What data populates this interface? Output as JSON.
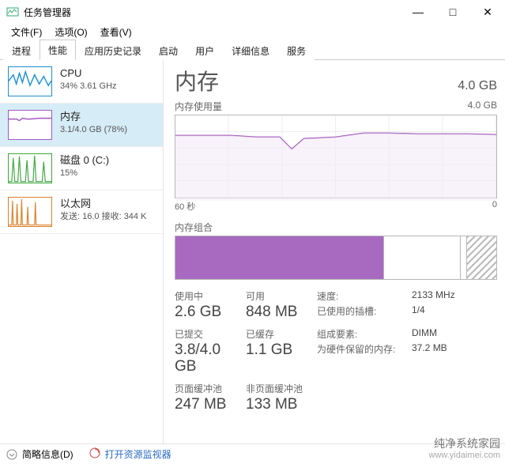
{
  "window": {
    "title": "任务管理器",
    "controls": {
      "min": "—",
      "max": "□",
      "close": "✕"
    }
  },
  "menu": {
    "file": "文件(F)",
    "options": "选项(O)",
    "view": "查看(V)"
  },
  "tabs": {
    "processes": "进程",
    "performance": "性能",
    "history": "应用历史记录",
    "startup": "启动",
    "users": "用户",
    "details": "详细信息",
    "services": "服务"
  },
  "sidebar": [
    {
      "key": "cpu",
      "title": "CPU",
      "sub": "34%  3.61 GHz"
    },
    {
      "key": "memory",
      "title": "内存",
      "sub": "3.1/4.0 GB (78%)"
    },
    {
      "key": "disk",
      "title": "磁盘 0 (C:)",
      "sub": "15%"
    },
    {
      "key": "eth",
      "title": "以太网",
      "sub": "发送: 16.0  接收: 344 K"
    }
  ],
  "main": {
    "title": "内存",
    "capacity": "4.0 GB",
    "usage_label": "内存使用量",
    "usage_cap": "4.0 GB",
    "axis_left": "60 秒",
    "axis_right": "0",
    "comp_label": "内存组合",
    "stats": {
      "in_use_lbl": "使用中",
      "in_use_val": "2.6 GB",
      "avail_lbl": "可用",
      "avail_val": "848 MB",
      "commit_lbl": "已提交",
      "commit_val": "3.8/4.0 GB",
      "cached_lbl": "已缓存",
      "cached_val": "1.1 GB",
      "paged_lbl": "页面缓冲池",
      "paged_val": "247 MB",
      "nonpaged_lbl": "非页面缓冲池",
      "nonpaged_val": "133 MB"
    },
    "right": {
      "speed_lbl": "速度:",
      "speed_val": "2133 MHz",
      "slots_lbl": "已使用的插槽:",
      "slots_val": "1/4",
      "form_lbl": "组成要素:",
      "form_val": "DIMM",
      "hw_lbl": "为硬件保留的内存:",
      "hw_val": "37.2 MB"
    },
    "composition": {
      "used_pct": 65,
      "margin_pct": 24,
      "free_pct": 2,
      "hw_pct": 9
    }
  },
  "bottom": {
    "less": "简略信息(D)",
    "resmon": "打开资源监视器"
  },
  "watermark": {
    "line1": "纯净系统家园",
    "line2": "www.yidaimei.com"
  },
  "chart_data": {
    "type": "line",
    "title": "内存使用量",
    "xlabel": "60 秒 → 0",
    "ylabel": "GB",
    "ylim": [
      0,
      4.0
    ],
    "x": [
      0,
      5,
      10,
      15,
      20,
      22,
      25,
      30,
      35,
      40,
      45,
      50,
      55,
      60
    ],
    "series": [
      {
        "name": "内存使用量 (GB)",
        "values": [
          3.05,
          3.05,
          3.05,
          3.0,
          3.0,
          2.55,
          2.95,
          3.0,
          3.15,
          3.15,
          3.12,
          3.12,
          3.12,
          3.1
        ]
      }
    ]
  }
}
